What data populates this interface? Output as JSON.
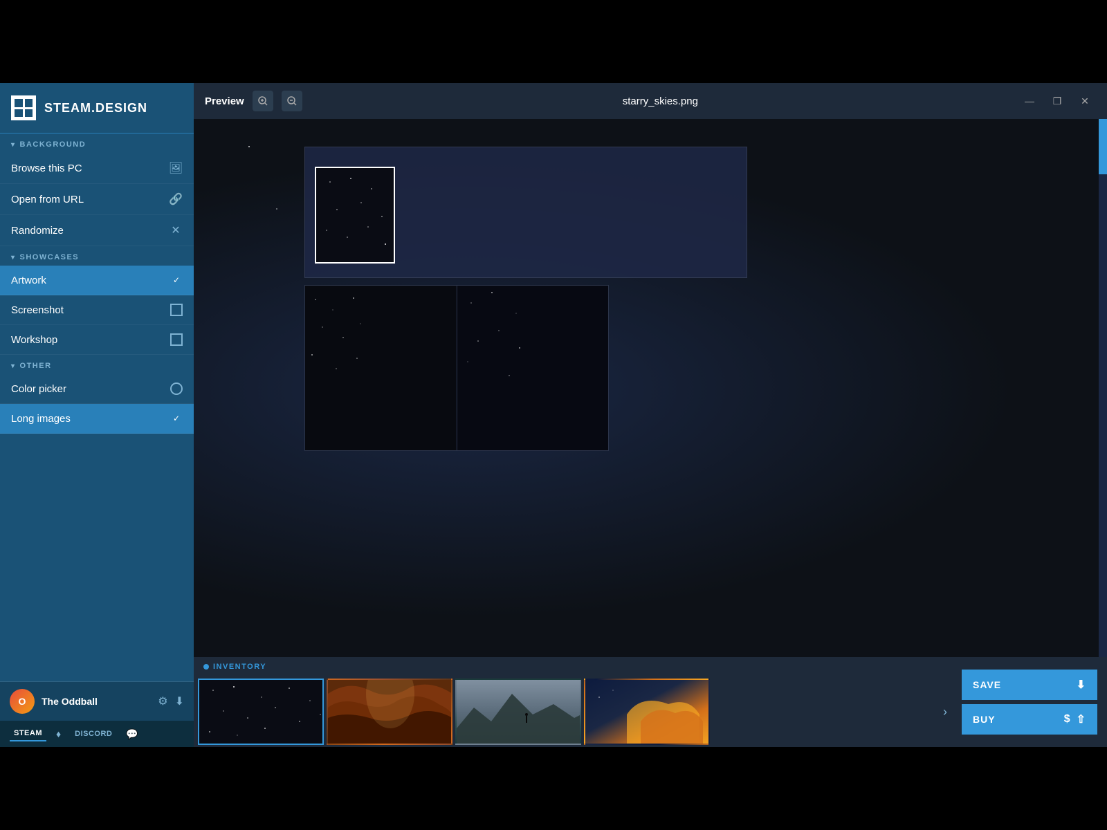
{
  "app": {
    "title": "STEAM.DESIGN"
  },
  "titlebar": {
    "preview_label": "Preview",
    "filename": "starry_skies.png",
    "zoom_in_label": "+",
    "zoom_out_label": "−",
    "minimize_label": "—",
    "maximize_label": "❐",
    "close_label": "✕"
  },
  "sidebar": {
    "logo_alt": "Steam Design Logo",
    "title": "STEAM.DESIGN",
    "sections": [
      {
        "id": "background",
        "label": "BACKGROUND",
        "items": [
          {
            "id": "browse-pc",
            "label": "Browse this PC",
            "icon": "image",
            "type": "icon"
          },
          {
            "id": "open-url",
            "label": "Open from URL",
            "icon": "link",
            "type": "icon"
          },
          {
            "id": "randomize",
            "label": "Randomize",
            "icon": "shuffle",
            "type": "icon"
          }
        ]
      },
      {
        "id": "showcases",
        "label": "SHOWCASES",
        "items": [
          {
            "id": "artwork",
            "label": "Artwork",
            "checked": true,
            "type": "checkbox"
          },
          {
            "id": "screenshot",
            "label": "Screenshot",
            "checked": false,
            "type": "checkbox"
          },
          {
            "id": "workshop",
            "label": "Workshop",
            "checked": false,
            "type": "checkbox"
          }
        ]
      },
      {
        "id": "other",
        "label": "OTHER",
        "items": [
          {
            "id": "color-picker",
            "label": "Color picker",
            "type": "radio"
          },
          {
            "id": "long-images",
            "label": "Long images",
            "checked": true,
            "type": "checkbox"
          }
        ]
      }
    ],
    "user": {
      "name": "The Oddball",
      "avatar_initials": "O"
    },
    "tabs": [
      {
        "id": "steam",
        "label": "STEAM",
        "active": true
      },
      {
        "id": "steam-icon",
        "label": "♦"
      },
      {
        "id": "discord",
        "label": "DISCORD"
      },
      {
        "id": "discord-icon",
        "label": "💬"
      }
    ]
  },
  "inventory": {
    "label": "INVENTORY",
    "thumbnails": [
      {
        "id": "thumb-1",
        "alt": "Starry sky dark",
        "style": "dark-stars",
        "selected": true
      },
      {
        "id": "thumb-2",
        "alt": "Canyon orange",
        "style": "canyon"
      },
      {
        "id": "thumb-3",
        "alt": "Mountain silhouette",
        "style": "mountain"
      },
      {
        "id": "thumb-4",
        "alt": "Sunset clouds",
        "style": "sunset"
      }
    ]
  },
  "actions": {
    "save_label": "SAVE",
    "save_icon": "⬇",
    "buy_label": "BUY",
    "buy_icon_dollar": "$",
    "buy_icon_share": "⇧"
  }
}
